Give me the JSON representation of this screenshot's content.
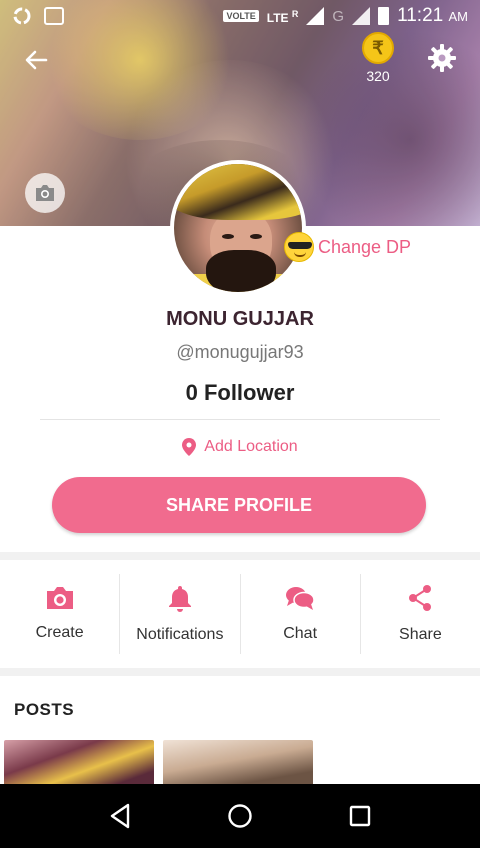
{
  "status_bar": {
    "network_badge": "VOLTE",
    "lte": "LTE",
    "roaming": "R",
    "carrier2": "G",
    "time": "11:21",
    "ampm": "AM"
  },
  "header": {
    "coin_symbol": "₹",
    "coin_count": "320"
  },
  "profile": {
    "change_dp_label": "Change DP",
    "name": "MONU GUJJAR",
    "handle": "@monugujjar93",
    "followers": "0 Follower",
    "location_label": "Add Location",
    "share_button": "SHARE PROFILE"
  },
  "actions": [
    {
      "label": "Create",
      "icon": "camera-icon"
    },
    {
      "label": "Notifications",
      "icon": "bell-icon"
    },
    {
      "label": "Chat",
      "icon": "chat-icon"
    },
    {
      "label": "Share",
      "icon": "share-icon"
    }
  ],
  "posts": {
    "title": "POSTS"
  },
  "colors": {
    "accent": "#ec5d84",
    "button": "#f16b8e",
    "name": "#3c2430"
  }
}
